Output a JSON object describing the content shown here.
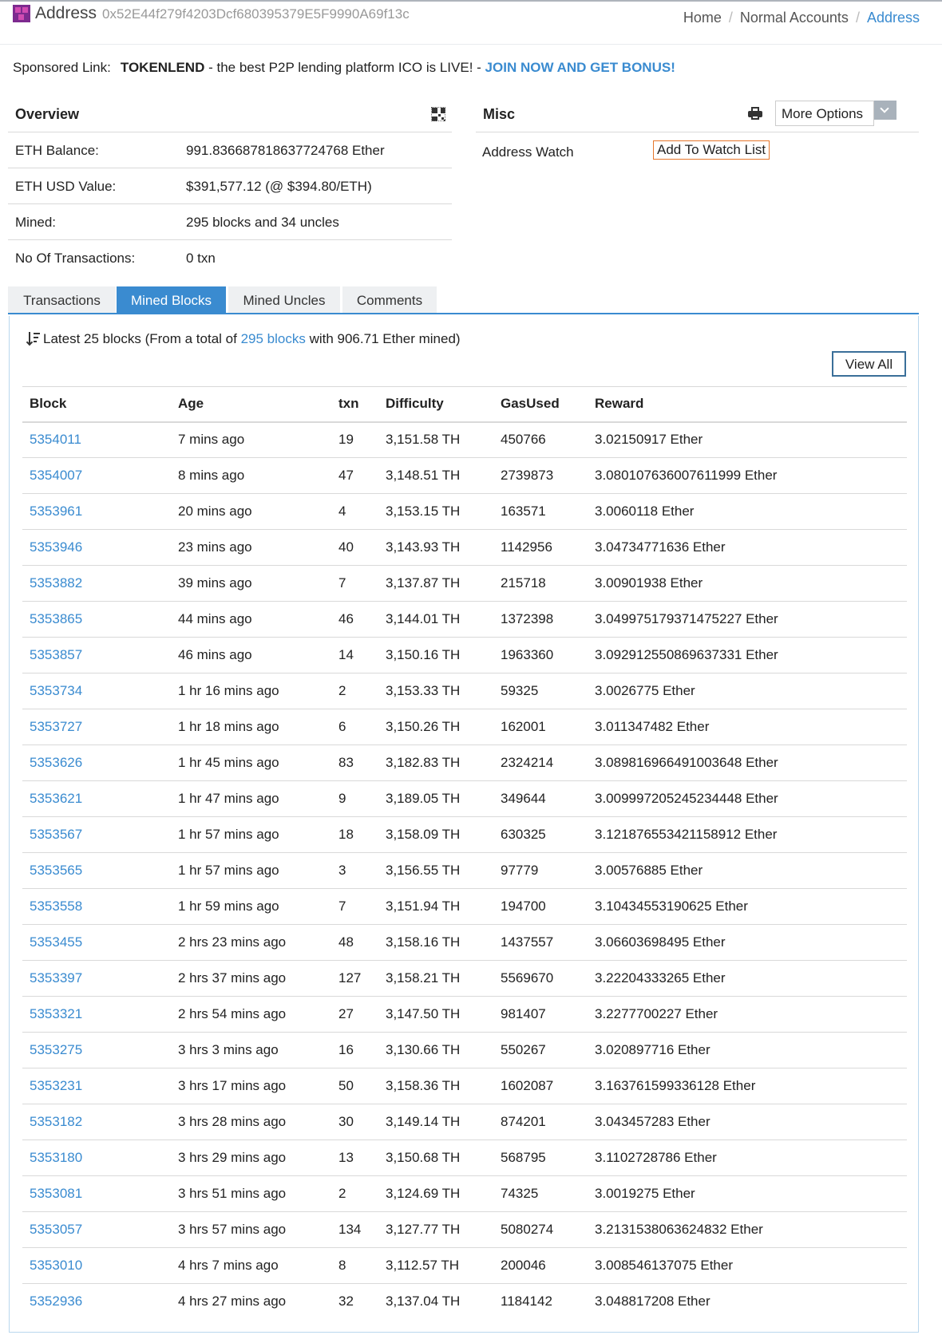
{
  "header": {
    "title": "Address",
    "address": "0x52E44f279f4203Dcf680395379E5F9990A69f13c",
    "breadcrumb": [
      {
        "label": "Home"
      },
      {
        "label": "Normal Accounts"
      },
      {
        "label": "Address"
      }
    ]
  },
  "sponsored": {
    "prefix": "Sponsored Link:",
    "brand": "TOKENLEND",
    "text": " - the best P2P lending platform ICO is LIVE! - ",
    "cta": "JOIN NOW AND GET BONUS!"
  },
  "overview": {
    "title": "Overview",
    "qr_icon": "qr-code-icon",
    "rows": [
      {
        "label": "ETH Balance:",
        "value": "991.836687818637724768 Ether"
      },
      {
        "label": "ETH USD Value:",
        "value": "$391,577.12 (@ $394.80/ETH)"
      },
      {
        "label": "Mined:",
        "value": "295 blocks and 34 uncles"
      },
      {
        "label": "No Of Transactions:",
        "value": "0 txn"
      }
    ]
  },
  "misc": {
    "title": "Misc",
    "print_icon": "print-icon",
    "more_options": "More Options",
    "watch_label": "Address Watch",
    "watch_button": "Add To Watch List"
  },
  "tabs": [
    {
      "label": "Transactions",
      "active": false
    },
    {
      "label": "Mined Blocks",
      "active": true
    },
    {
      "label": "Mined Uncles",
      "active": false
    },
    {
      "label": "Comments",
      "active": false
    }
  ],
  "summary": {
    "prefix": "Latest 25 blocks (From a total of ",
    "link": "295 blocks",
    "suffix": " with 906.71 Ether mined)"
  },
  "view_all": "View All",
  "table": {
    "columns": [
      "Block",
      "Age",
      "txn",
      "Difficulty",
      "GasUsed",
      "Reward"
    ],
    "rows": [
      [
        "5354011",
        "7 mins ago",
        "19",
        "3,151.58 TH",
        "450766",
        "3.02150917 Ether"
      ],
      [
        "5354007",
        "8 mins ago",
        "47",
        "3,148.51 TH",
        "2739873",
        "3.080107636007611999 Ether"
      ],
      [
        "5353961",
        "20 mins ago",
        "4",
        "3,153.15 TH",
        "163571",
        "3.0060118 Ether"
      ],
      [
        "5353946",
        "23 mins ago",
        "40",
        "3,143.93 TH",
        "1142956",
        "3.04734771636 Ether"
      ],
      [
        "5353882",
        "39 mins ago",
        "7",
        "3,137.87 TH",
        "215718",
        "3.00901938 Ether"
      ],
      [
        "5353865",
        "44 mins ago",
        "46",
        "3,144.01 TH",
        "1372398",
        "3.049975179371475227 Ether"
      ],
      [
        "5353857",
        "46 mins ago",
        "14",
        "3,150.16 TH",
        "1963360",
        "3.092912550869637331 Ether"
      ],
      [
        "5353734",
        "1 hr 16 mins ago",
        "2",
        "3,153.33 TH",
        "59325",
        "3.0026775 Ether"
      ],
      [
        "5353727",
        "1 hr 18 mins ago",
        "6",
        "3,150.26 TH",
        "162001",
        "3.011347482 Ether"
      ],
      [
        "5353626",
        "1 hr 45 mins ago",
        "83",
        "3,182.83 TH",
        "2324214",
        "3.089816966491003648 Ether"
      ],
      [
        "5353621",
        "1 hr 47 mins ago",
        "9",
        "3,189.05 TH",
        "349644",
        "3.009997205245234448 Ether"
      ],
      [
        "5353567",
        "1 hr 57 mins ago",
        "18",
        "3,158.09 TH",
        "630325",
        "3.121876553421158912 Ether"
      ],
      [
        "5353565",
        "1 hr 57 mins ago",
        "3",
        "3,156.55 TH",
        "97779",
        "3.00576885 Ether"
      ],
      [
        "5353558",
        "1 hr 59 mins ago",
        "7",
        "3,151.94 TH",
        "194700",
        "3.10434553190625 Ether"
      ],
      [
        "5353455",
        "2 hrs 23 mins ago",
        "48",
        "3,158.16 TH",
        "1437557",
        "3.06603698495 Ether"
      ],
      [
        "5353397",
        "2 hrs 37 mins ago",
        "127",
        "3,158.21 TH",
        "5569670",
        "3.22204333265 Ether"
      ],
      [
        "5353321",
        "2 hrs 54 mins ago",
        "27",
        "3,147.50 TH",
        "981407",
        "3.2277700227 Ether"
      ],
      [
        "5353275",
        "3 hrs 3 mins ago",
        "16",
        "3,130.66 TH",
        "550267",
        "3.020897716 Ether"
      ],
      [
        "5353231",
        "3 hrs 17 mins ago",
        "50",
        "3,158.36 TH",
        "1602087",
        "3.163761599336128 Ether"
      ],
      [
        "5353182",
        "3 hrs 28 mins ago",
        "30",
        "3,149.14 TH",
        "874201",
        "3.043457283 Ether"
      ],
      [
        "5353180",
        "3 hrs 29 mins ago",
        "13",
        "3,150.68 TH",
        "568795",
        "3.1102728786 Ether"
      ],
      [
        "5353081",
        "3 hrs 51 mins ago",
        "2",
        "3,124.69 TH",
        "74325",
        "3.0019275 Ether"
      ],
      [
        "5353057",
        "3 hrs 57 mins ago",
        "134",
        "3,127.77 TH",
        "5080274",
        "3.2131538063624832 Ether"
      ],
      [
        "5353010",
        "4 hrs 7 mins ago",
        "8",
        "3,112.57 TH",
        "200046",
        "3.008546137075 Ether"
      ],
      [
        "5352936",
        "4 hrs 27 mins ago",
        "32",
        "3,137.04 TH",
        "1184142",
        "3.048817208 Ether"
      ]
    ]
  },
  "colors": {
    "accent": "#3a8bd0",
    "watch_border": "#e6762b"
  }
}
